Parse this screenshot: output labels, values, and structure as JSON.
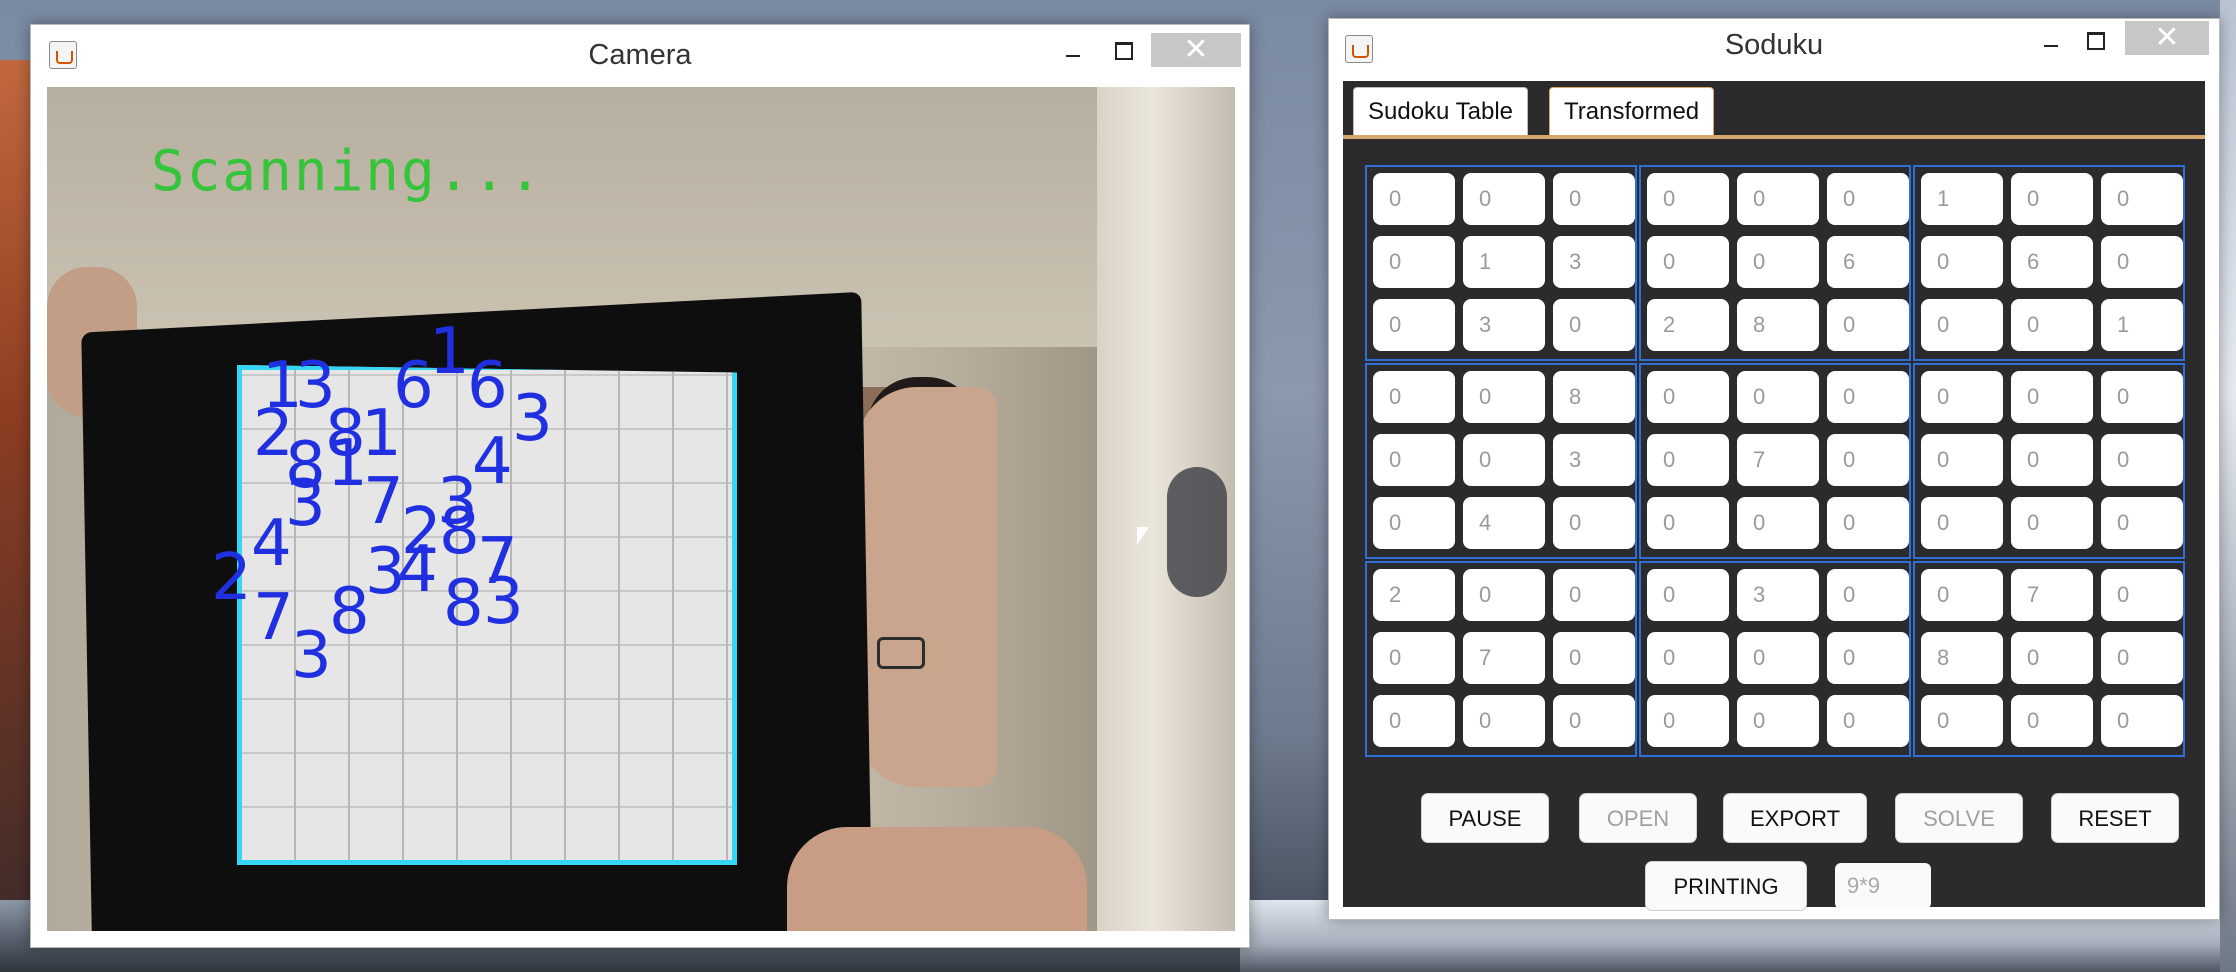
{
  "camera_window": {
    "title": "Camera",
    "overlay_status": "Scanning...",
    "detected_digits": [
      {
        "text": "1",
        "color": "#2030e0"
      },
      {
        "text": "3",
        "color": "#2030e0"
      },
      {
        "text": "6",
        "color": "#2030e0"
      },
      {
        "text": "6",
        "color": "#2030e0"
      },
      {
        "text": "1",
        "color": "#2030e0"
      },
      {
        "text": "3",
        "color": "#2030e0"
      },
      {
        "text": "2",
        "color": "#2030e0"
      },
      {
        "text": "8",
        "color": "#2030e0"
      },
      {
        "text": "1",
        "color": "#2030e0"
      },
      {
        "text": "8",
        "color": "#2030e0"
      },
      {
        "text": "1",
        "color": "#2030e0"
      },
      {
        "text": "4",
        "color": "#2030e0"
      },
      {
        "text": "3",
        "color": "#2030e0"
      },
      {
        "text": "7",
        "color": "#2030e0"
      },
      {
        "text": "3",
        "color": "#2030e0"
      },
      {
        "text": "2",
        "color": "#2030e0"
      },
      {
        "text": "8",
        "color": "#2030e0"
      },
      {
        "text": "4",
        "color": "#2030e0"
      },
      {
        "text": "7",
        "color": "#2030e0"
      },
      {
        "text": "2",
        "color": "#2030e0"
      },
      {
        "text": "3",
        "color": "#2030e0"
      },
      {
        "text": "4",
        "color": "#2030e0"
      },
      {
        "text": "7",
        "color": "#2030e0"
      },
      {
        "text": "8",
        "color": "#2030e0"
      },
      {
        "text": "8",
        "color": "#2030e0"
      },
      {
        "text": "3",
        "color": "#2030e0"
      },
      {
        "text": "3",
        "color": "#2030e0"
      }
    ],
    "status_color": "#36c43a",
    "outline_color": "#33d6f5"
  },
  "soduku_window": {
    "title": "Soduku",
    "tabs": [
      {
        "label": "Sudoku Table",
        "selected": true
      },
      {
        "label": "Transformed",
        "selected": false
      }
    ],
    "grid": [
      [
        "0",
        "0",
        "0",
        "0",
        "0",
        "0",
        "1",
        "0",
        "0"
      ],
      [
        "0",
        "1",
        "3",
        "0",
        "0",
        "6",
        "0",
        "6",
        "0"
      ],
      [
        "0",
        "3",
        "0",
        "2",
        "8",
        "0",
        "0",
        "0",
        "1"
      ],
      [
        "0",
        "0",
        "8",
        "0",
        "0",
        "0",
        "0",
        "0",
        "0"
      ],
      [
        "0",
        "0",
        "3",
        "0",
        "7",
        "0",
        "0",
        "0",
        "0"
      ],
      [
        "0",
        "4",
        "0",
        "0",
        "0",
        "0",
        "0",
        "0",
        "0"
      ],
      [
        "2",
        "0",
        "0",
        "0",
        "3",
        "0",
        "0",
        "7",
        "0"
      ],
      [
        "0",
        "7",
        "0",
        "0",
        "0",
        "0",
        "8",
        "0",
        "0"
      ],
      [
        "0",
        "0",
        "0",
        "0",
        "0",
        "0",
        "0",
        "0",
        "0"
      ]
    ],
    "buttons": {
      "pause": {
        "label": "PAUSE",
        "enabled": true
      },
      "open": {
        "label": "OPEN",
        "enabled": false
      },
      "export": {
        "label": "EXPORT",
        "enabled": true
      },
      "solve": {
        "label": "SOLVE",
        "enabled": false
      },
      "reset": {
        "label": "RESET",
        "enabled": true
      },
      "printing": {
        "label": "PRINTING",
        "enabled": true
      }
    },
    "size_field": {
      "placeholder": "9*9"
    },
    "grid_border_color": "#2f6fd8"
  }
}
